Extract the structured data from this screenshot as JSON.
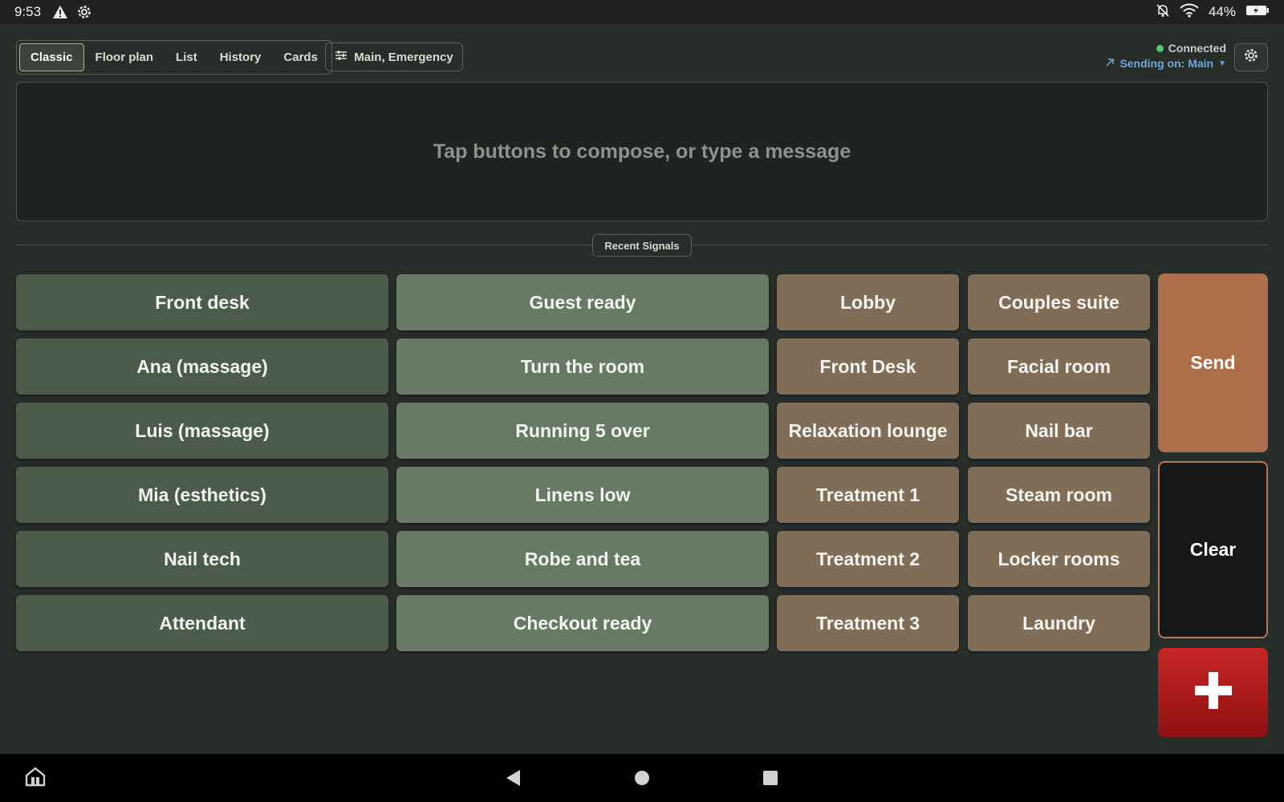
{
  "status_bar": {
    "time": "9:53",
    "battery": "44%",
    "icons": [
      "warning-icon",
      "gear-icon",
      "notifications-off-icon",
      "wifi-icon",
      "battery-icon"
    ]
  },
  "tabs": [
    {
      "label": "Classic",
      "active": true
    },
    {
      "label": "Floor plan",
      "active": false
    },
    {
      "label": "List",
      "active": false
    },
    {
      "label": "History",
      "active": false
    },
    {
      "label": "Cards",
      "active": false
    }
  ],
  "channel_filter": {
    "label": "Main, Emergency",
    "icon": "sliders-icon"
  },
  "connection": {
    "status": "Connected",
    "status_color": "#4fc872",
    "sending": "Sending on: Main",
    "sending_color": "#6fa8dc"
  },
  "compose": {
    "placeholder": "Tap buttons to compose, or type a message"
  },
  "recent_signals": {
    "label": "Recent Signals"
  },
  "columns": {
    "people": [
      "Front desk",
      "Ana (massage)",
      "Luis (massage)",
      "Mia (esthetics)",
      "Nail tech",
      "Attendant"
    ],
    "messages": [
      "Guest ready",
      "Turn the room",
      "Running 5 over",
      "Linens low",
      "Robe and tea",
      "Checkout ready"
    ],
    "locations_a": [
      "Lobby",
      "Front Desk",
      "Relaxation lounge",
      "Treatment 1",
      "Treatment 2",
      "Treatment 3"
    ],
    "locations_b": [
      "Couples suite",
      "Facial room",
      "Nail bar",
      "Steam room",
      "Locker rooms",
      "Laundry"
    ]
  },
  "colors": {
    "people": "#4b5c4b",
    "messages": "#677b64",
    "locations": "#806d57",
    "send": "#ae6e49",
    "emergency": "#c62626"
  },
  "actions": {
    "send": "Send",
    "clear": "Clear",
    "emergency_icon": "plus-icon"
  },
  "nav_bar": {
    "icons": [
      "home-app-icon",
      "back-icon",
      "home-icon",
      "recents-icon"
    ]
  }
}
